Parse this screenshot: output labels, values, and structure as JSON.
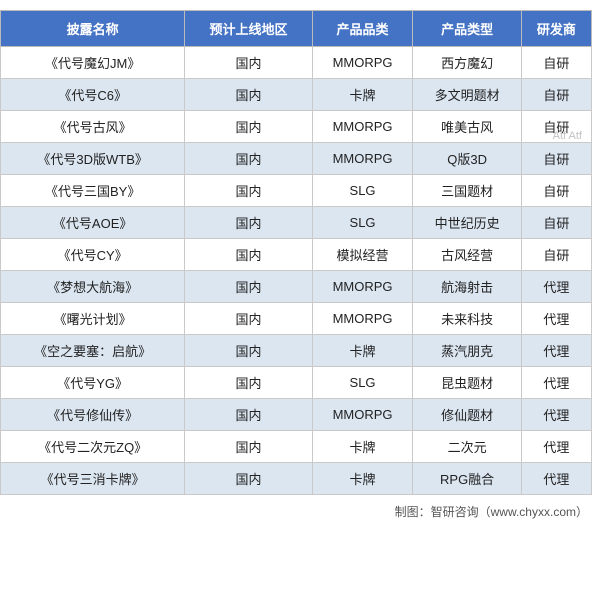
{
  "table": {
    "headers": [
      "披露名称",
      "预计上线地区",
      "产品品类",
      "产品类型",
      "研发商"
    ],
    "rows": [
      [
        "《代号魔幻JM》",
        "国内",
        "MMORPG",
        "西方魔幻",
        "自研"
      ],
      [
        "《代号C6》",
        "国内",
        "卡牌",
        "多文明题材",
        "自研"
      ],
      [
        "《代号古风》",
        "国内",
        "MMORPG",
        "唯美古风",
        "自研"
      ],
      [
        "《代号3D版WTB》",
        "国内",
        "MMORPG",
        "Q版3D",
        "自研"
      ],
      [
        "《代号三国BY》",
        "国内",
        "SLG",
        "三国题材",
        "自研"
      ],
      [
        "《代号AOE》",
        "国内",
        "SLG",
        "中世纪历史",
        "自研"
      ],
      [
        "《代号CY》",
        "国内",
        "模拟经营",
        "古风经营",
        "自研"
      ],
      [
        "《梦想大航海》",
        "国内",
        "MMORPG",
        "航海射击",
        "代理"
      ],
      [
        "《曙光计划》",
        "国内",
        "MMORPG",
        "未来科技",
        "代理"
      ],
      [
        "《空之要塞：启航》",
        "国内",
        "卡牌",
        "蒸汽朋克",
        "代理"
      ],
      [
        "《代号YG》",
        "国内",
        "SLG",
        "昆虫题材",
        "代理"
      ],
      [
        "《代号修仙传》",
        "国内",
        "MMORPG",
        "修仙题材",
        "代理"
      ],
      [
        "《代号二次元ZQ》",
        "国内",
        "卡牌",
        "二次元",
        "代理"
      ],
      [
        "《代号三消卡牌》",
        "国内",
        "卡牌",
        "RPG融合",
        "代理"
      ]
    ]
  },
  "footer": "制图：智研咨询（www.chyxx.com）",
  "watermark": "Atf Atf"
}
